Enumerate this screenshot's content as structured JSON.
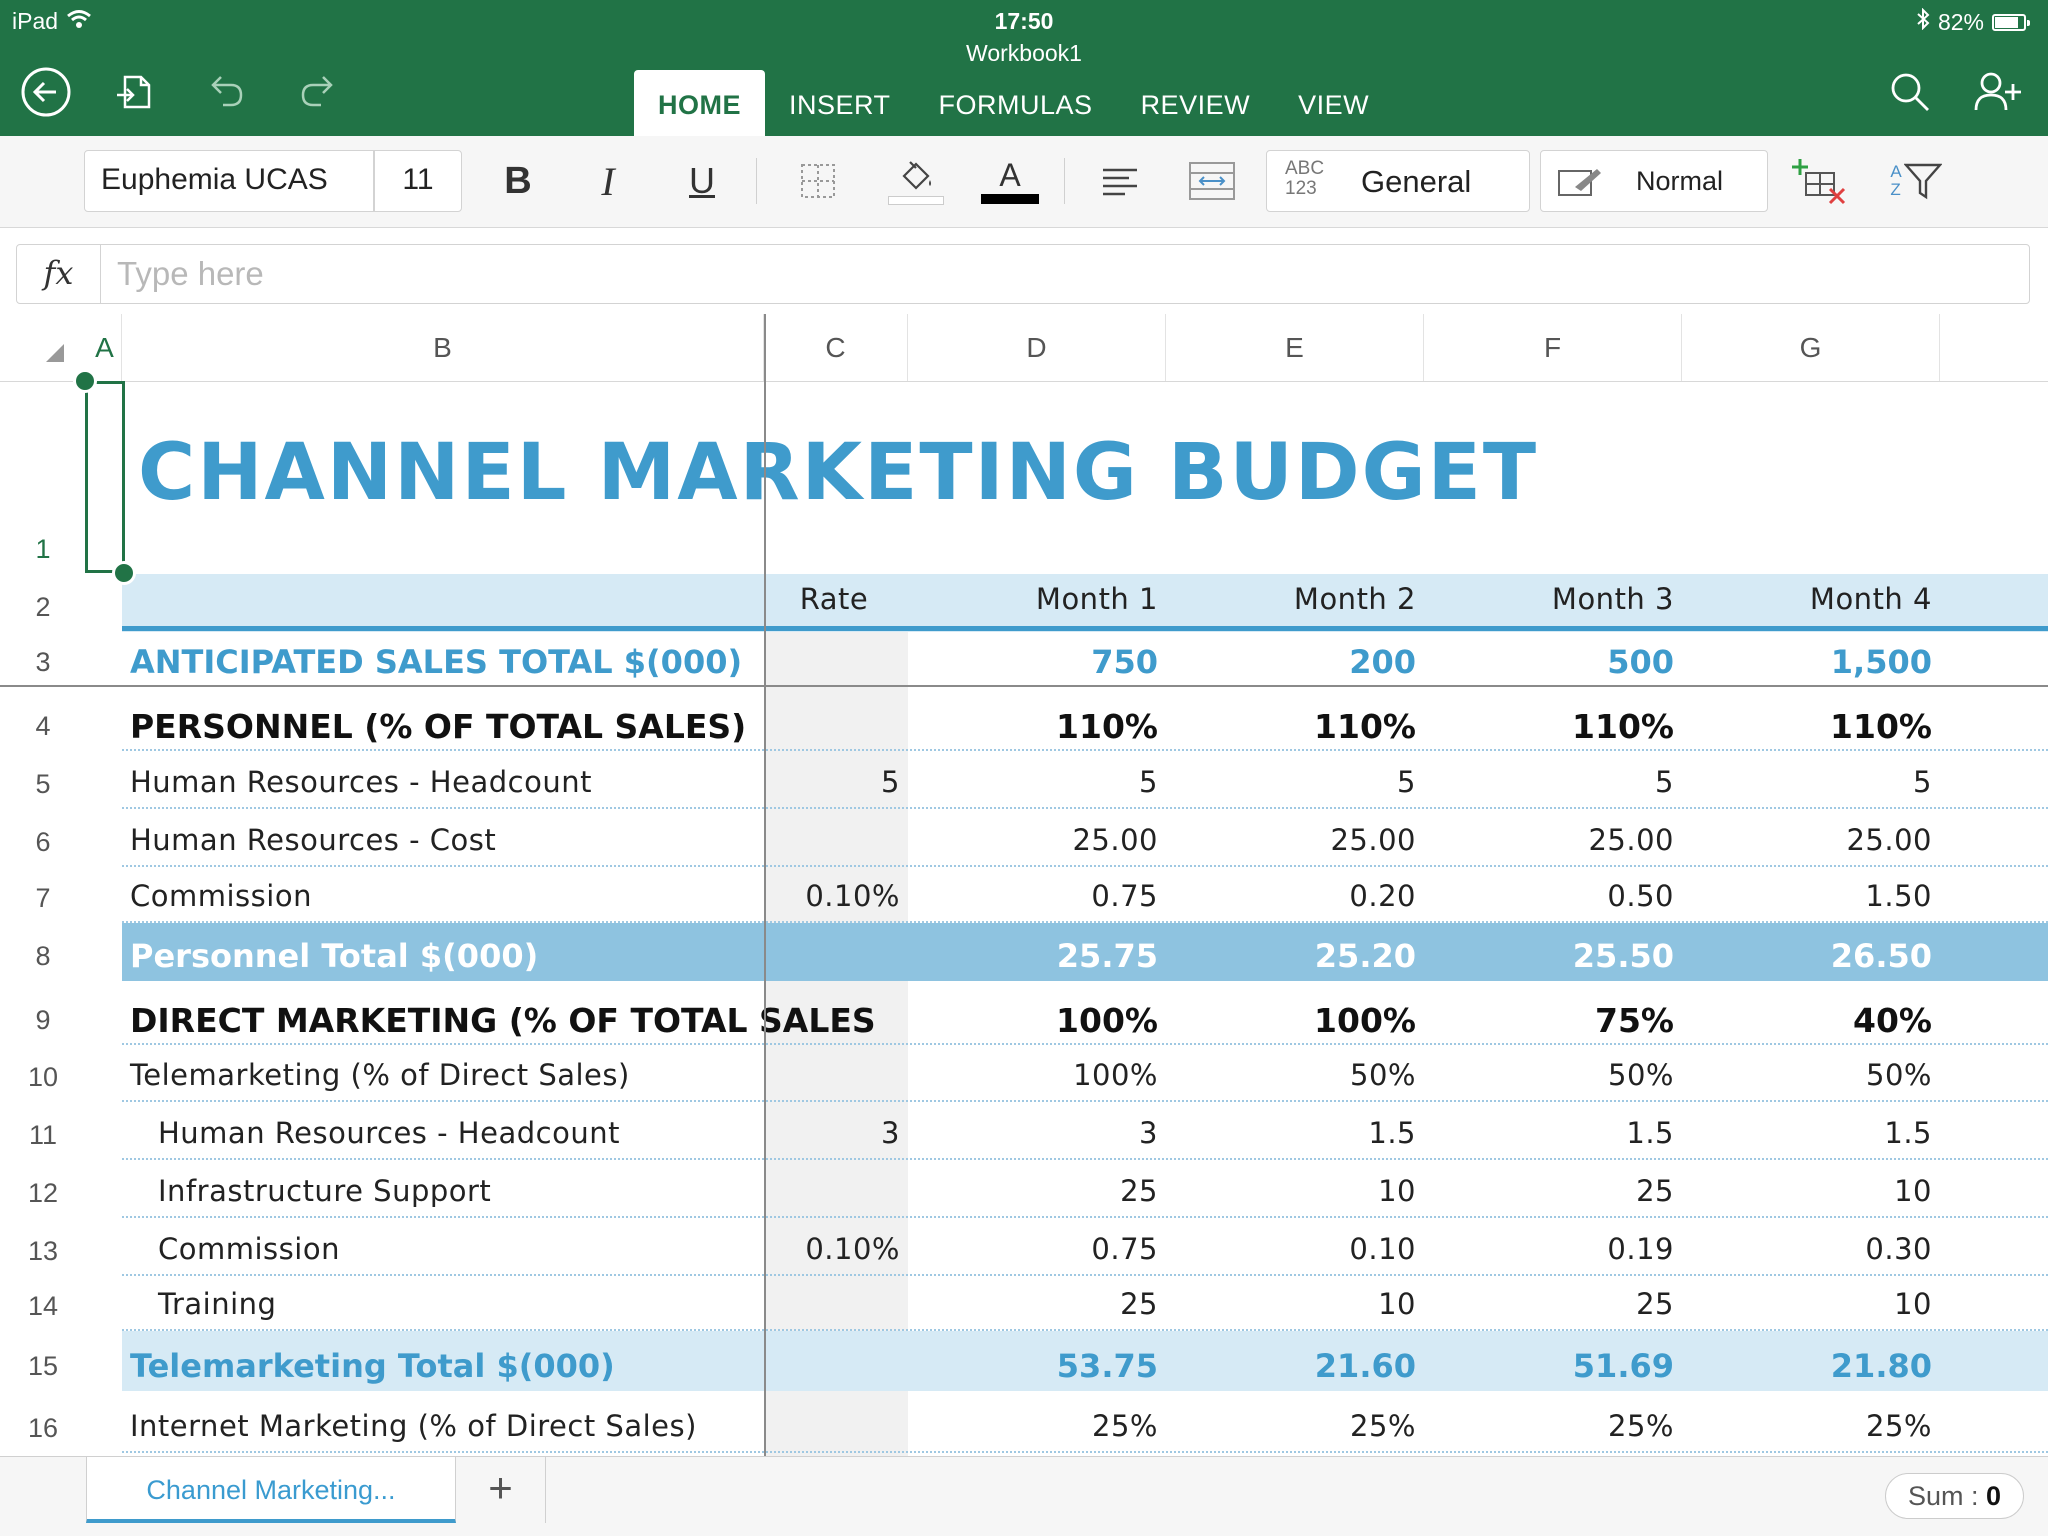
{
  "status": {
    "device": "iPad",
    "time": "17:50",
    "battery": "82%",
    "battery_level": 0.82
  },
  "doc_title": "Workbook1",
  "tabs": [
    "HOME",
    "INSERT",
    "FORMULAS",
    "REVIEW",
    "VIEW"
  ],
  "active_tab": "HOME",
  "toolbar": {
    "font_name": "Euphemia UCAS",
    "font_size": "11",
    "bold": "B",
    "italic": "I",
    "underline": "U",
    "font_color_glyph": "A",
    "number_format_icon": "ABC 123",
    "number_format_top": "ABC",
    "number_format_bottom": "123",
    "number_format": "General",
    "cell_style": "Normal",
    "sort_icon_top": "A",
    "sort_icon_bottom": "Z",
    "fill_color": "#ffffff",
    "font_color": "#000000"
  },
  "formula": {
    "fx": "fx",
    "placeholder": "Type here",
    "value": ""
  },
  "grid": {
    "columns": [
      "A",
      "B",
      "C",
      "D",
      "E",
      "F",
      "G"
    ],
    "rows": [
      "1",
      "2",
      "3",
      "4",
      "5",
      "6",
      "7",
      "8",
      "9",
      "10",
      "11",
      "12",
      "13",
      "14",
      "15",
      "16"
    ],
    "title": "CHANNEL MARKETING BUDGET",
    "header": {
      "rate": "Rate",
      "months": [
        "Month  1",
        "Month  2",
        "Month  3",
        "Month  4"
      ]
    },
    "data_rows": [
      {
        "label": "ANTICIPATED SALES TOTAL $(000)",
        "rate": "",
        "values": [
          "750",
          "200",
          "500",
          "1,500"
        ]
      },
      {
        "label": "PERSONNEL (% OF TOTAL SALES)",
        "rate": "",
        "values": [
          "110%",
          "110%",
          "110%",
          "110%"
        ]
      },
      {
        "label": "Human  Resources  -  Headcount",
        "rate": "5",
        "values": [
          "5",
          "5",
          "5",
          "5"
        ]
      },
      {
        "label": "Human  Resources  -  Cost",
        "rate": "",
        "values": [
          "25.00",
          "25.00",
          "25.00",
          "25.00"
        ]
      },
      {
        "label": "Commission",
        "rate": "0.10%",
        "values": [
          "0.75",
          "0.20",
          "0.50",
          "1.50"
        ]
      },
      {
        "label": "Personnel Total $(000)",
        "rate": "",
        "values": [
          "25.75",
          "25.20",
          "25.50",
          "26.50"
        ]
      },
      {
        "label": "DIRECT MARKETING (% OF TOTAL SALES",
        "rate": "",
        "values": [
          "100%",
          "100%",
          "75%",
          "40%"
        ]
      },
      {
        "label": "Telemarketing  (%  of  Direct  Sales)",
        "rate": "",
        "values": [
          "100%",
          "50%",
          "50%",
          "50%"
        ]
      },
      {
        "label": "Human  Resources  -  Headcount",
        "rate": "3",
        "values": [
          "3",
          "1.5",
          "1.5",
          "1.5"
        ]
      },
      {
        "label": "Infrastructure  Support",
        "rate": "",
        "values": [
          "25",
          "10",
          "25",
          "10"
        ]
      },
      {
        "label": "Commission",
        "rate": "0.10%",
        "values": [
          "0.75",
          "0.10",
          "0.19",
          "0.30"
        ]
      },
      {
        "label": "Training",
        "rate": "",
        "values": [
          "25",
          "10",
          "25",
          "10"
        ]
      },
      {
        "label": "Telemarketing Total $(000)",
        "rate": "",
        "values": [
          "53.75",
          "21.60",
          "51.69",
          "21.80"
        ]
      },
      {
        "label": "Internet  Marketing  (%  of  Direct  Sales)",
        "rate": "",
        "values": [
          "25%",
          "25%",
          "25%",
          "25%"
        ]
      }
    ]
  },
  "sheets": {
    "active": "Channel Marketing...",
    "add": "+"
  },
  "sum": {
    "label": "Sum : ",
    "value": "0"
  },
  "colors": {
    "brand_green": "#217346",
    "title_blue": "#3f9bcc",
    "band_light": "#d6eaf5",
    "band_mid": "#8ec3e0"
  }
}
